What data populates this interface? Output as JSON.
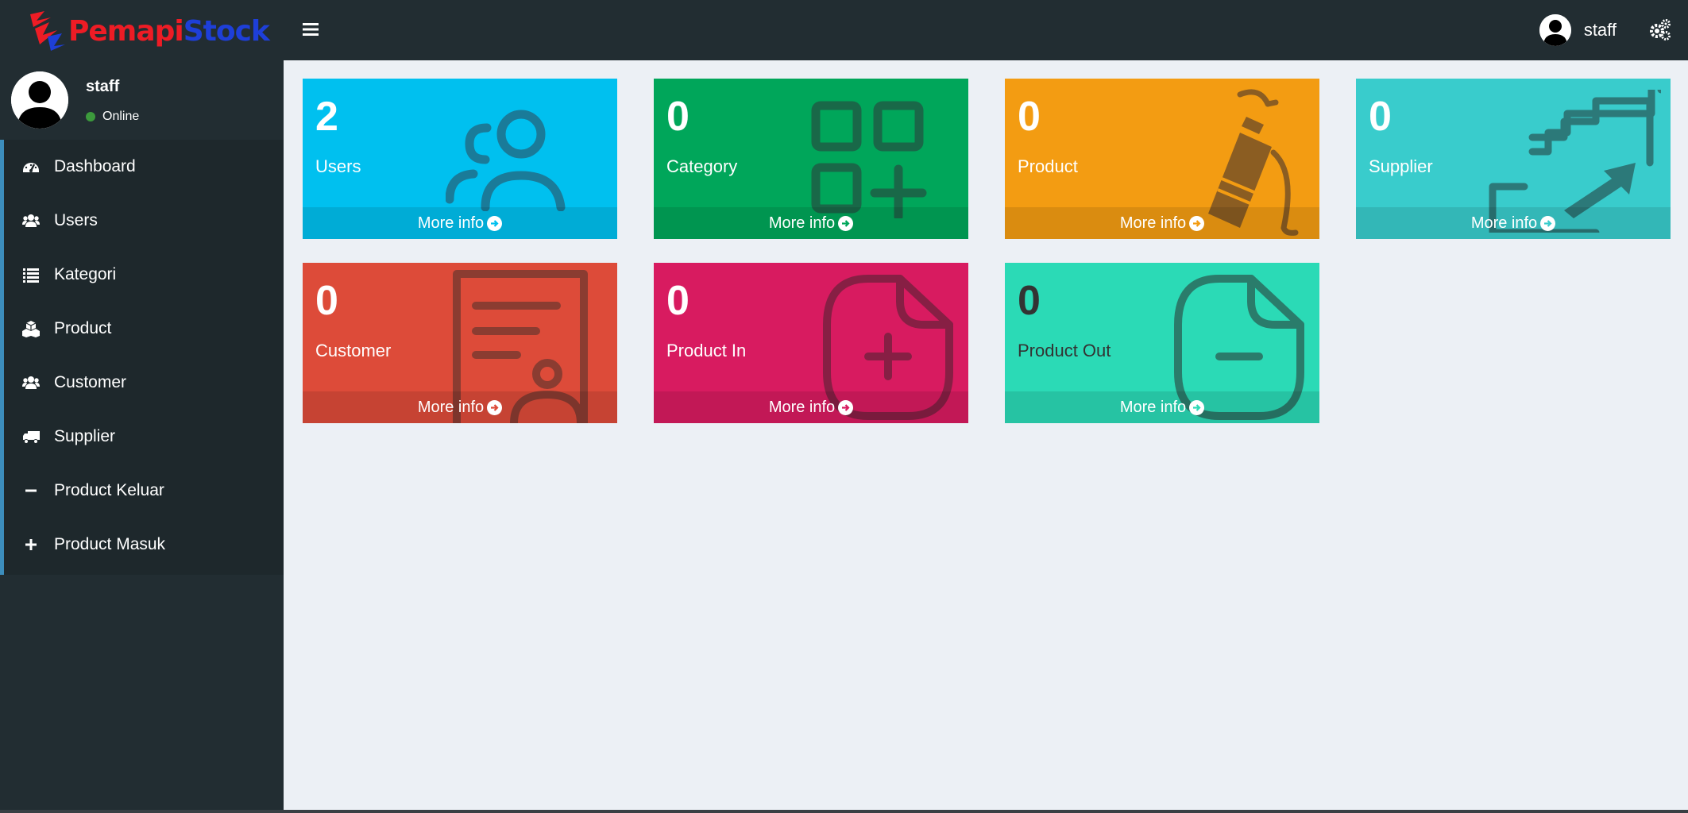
{
  "brand": {
    "part1": "Pemapi",
    "part2": "Stock"
  },
  "topbar": {
    "username": "staff"
  },
  "sidebar": {
    "user": {
      "name": "staff",
      "status": "Online"
    },
    "items": [
      {
        "label": "Dashboard",
        "icon": "dashboard-icon"
      },
      {
        "label": "Users",
        "icon": "users-icon"
      },
      {
        "label": "Kategori",
        "icon": "list-icon"
      },
      {
        "label": "Product",
        "icon": "cubes-icon"
      },
      {
        "label": "Customer",
        "icon": "users-icon"
      },
      {
        "label": "Supplier",
        "icon": "truck-icon"
      },
      {
        "label": "Product Keluar",
        "icon": "minus-icon"
      },
      {
        "label": "Product Masuk",
        "icon": "plus-icon"
      }
    ]
  },
  "boxes": [
    {
      "count": "2",
      "label": "Users",
      "footer": "More info",
      "color": "#00c0ef",
      "icon": "users-icon"
    },
    {
      "count": "0",
      "label": "Category",
      "footer": "More info",
      "color": "#00a65a",
      "icon": "category-grid-icon"
    },
    {
      "count": "0",
      "label": "Product",
      "footer": "More info",
      "color": "#f39c12",
      "icon": "extinguisher-icon"
    },
    {
      "count": "0",
      "label": "Supplier",
      "footer": "More info",
      "color": "#39cccc",
      "icon": "stairs-arrow-icon"
    },
    {
      "count": "0",
      "label": "Customer",
      "footer": "More info",
      "color": "#dd4b39",
      "icon": "report-user-icon"
    },
    {
      "count": "0",
      "label": "Product In",
      "footer": "More info",
      "color": "#d81b60",
      "icon": "file-plus-icon"
    },
    {
      "count": "0",
      "label": "Product Out",
      "footer": "More info",
      "color": "#2bdab6",
      "icon": "file-minus-icon"
    }
  ]
}
